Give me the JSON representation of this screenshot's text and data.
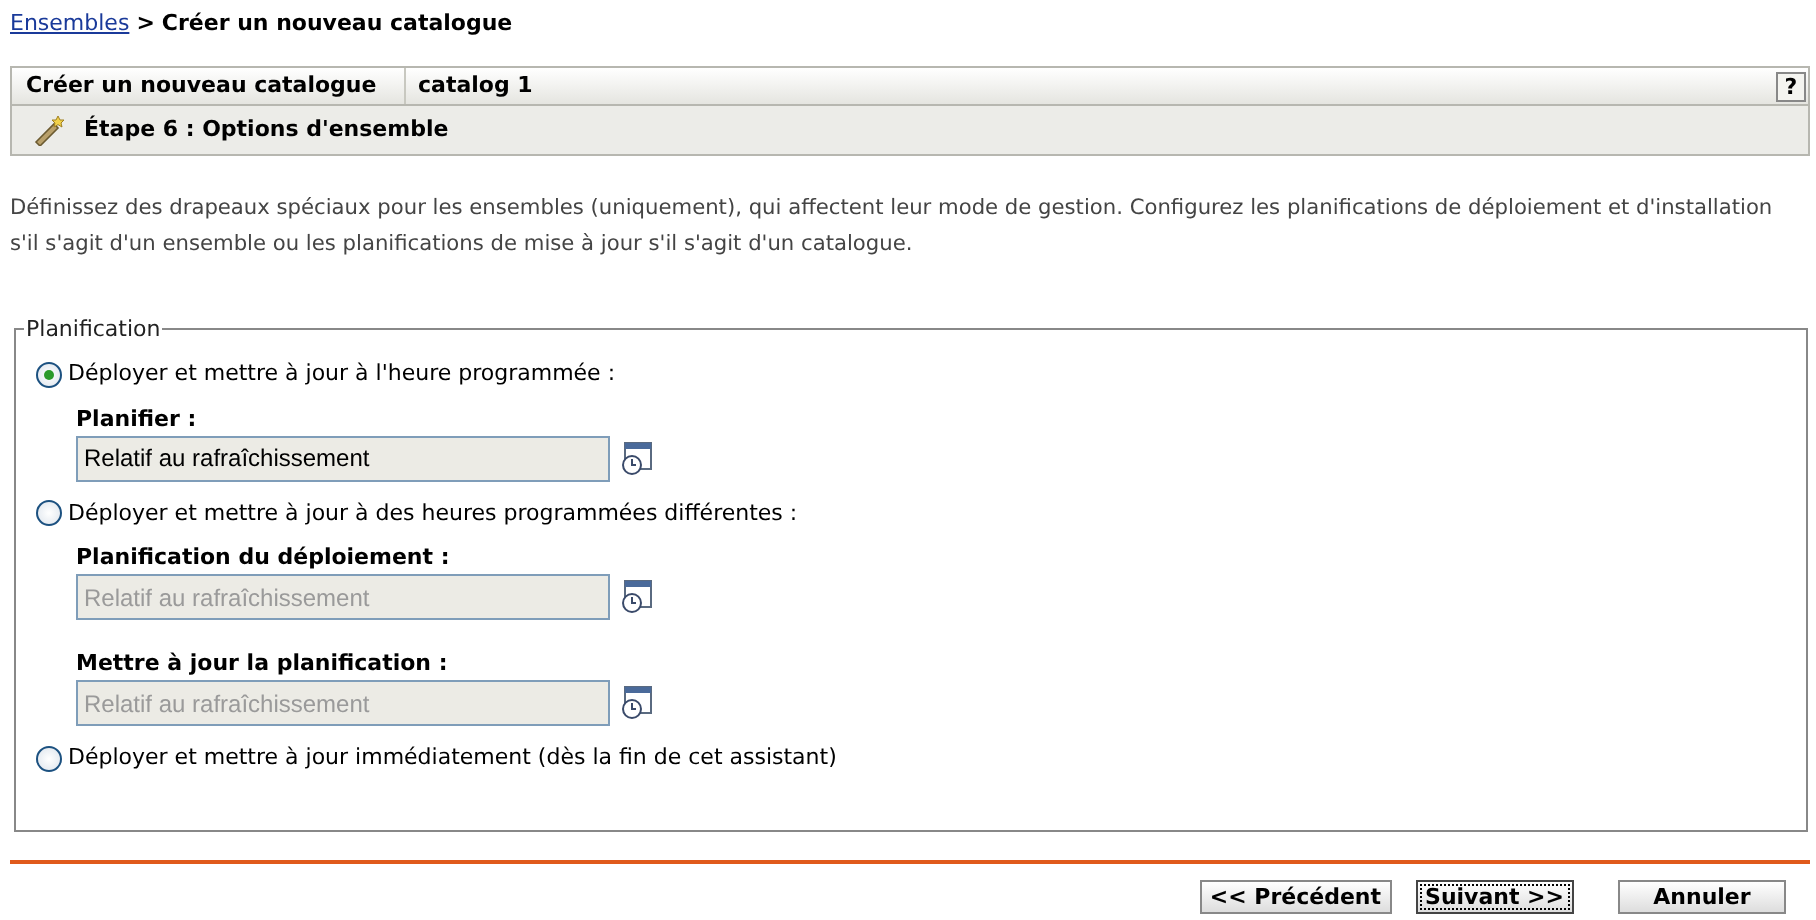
{
  "breadcrumb": {
    "link": "Ensembles",
    "separator": ">",
    "current": "Créer un nouveau catalogue"
  },
  "header": {
    "title": "Créer un nouveau catalogue",
    "name": "catalog 1",
    "help": "?",
    "step": "Étape 6 : Options d'ensemble"
  },
  "description": "Définissez des drapeaux spéciaux pour les ensembles (uniquement), qui affectent leur mode de gestion. Configurez les planifications de déploiement et d'installation s'il s'agit d'un ensemble ou les planifications de mise à jour s'il s'agit d'un catalogue.",
  "schedule": {
    "legend": "Planification",
    "options": [
      {
        "label": "Déployer et mettre à jour à l'heure programmée :",
        "selected": true,
        "fields": [
          {
            "label": "Planifier :",
            "value": "Relatif au rafraîchissement",
            "disabled": false
          }
        ]
      },
      {
        "label": "Déployer et mettre à jour à des heures programmées différentes :",
        "selected": false,
        "fields": [
          {
            "label": "Planification du déploiement :",
            "value": "Relatif au rafraîchissement",
            "disabled": true
          },
          {
            "label": "Mettre à jour la planification :",
            "value": "Relatif au rafraîchissement",
            "disabled": true
          }
        ]
      },
      {
        "label": "Déployer et mettre à jour immédiatement (dès la fin de cet assistant)",
        "selected": false
      }
    ]
  },
  "buttons": [
    {
      "label": "<< Précédent",
      "focused": false
    },
    {
      "label": "Suivant >>",
      "focused": true
    },
    {
      "label": "Annuler",
      "focused": false
    }
  ]
}
